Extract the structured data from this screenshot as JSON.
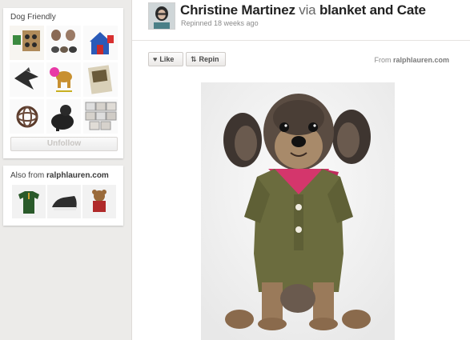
{
  "sidebar": {
    "board": {
      "title": "Dog Friendly",
      "thumbs": [
        "puppy-bowls-thumb",
        "dog-figurines-thumb",
        "red-doghouse-thumb",
        "bat-kite-thumb",
        "dog-balloon-thumb",
        "dog-book-thumb",
        "twig-ball-thumb",
        "black-dog-coat-thumb",
        "dog-photos-thumb"
      ],
      "unfollow_label": "Unfollow"
    },
    "also_from": {
      "prefix": "Also from ",
      "source": "ralphlauren.com",
      "thumbs": [
        "green-polo-thumb",
        "loafer-shoe-thumb",
        "teddy-bear-thumb"
      ]
    }
  },
  "pin": {
    "pinner": "Christine Martinez",
    "via_word": "via",
    "board_name": "blanket and Cate",
    "repinned": "Repinned 18 weeks ago",
    "like_label": "Like",
    "repin_label": "Repin",
    "source_prefix": "From",
    "source_domain": "ralphlauren.com",
    "like_icon": "heart-icon",
    "repin_icon": "repin-arrows-icon"
  },
  "colors": {
    "page_bg": "#f1efee",
    "card_bg": "#ffffff",
    "shirt": "#6b6c3e",
    "scarf": "#d4366c"
  }
}
